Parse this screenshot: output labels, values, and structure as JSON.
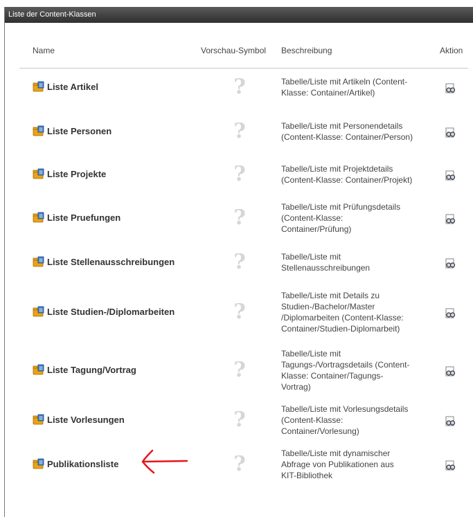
{
  "panel": {
    "title": "Liste der Content-Klassen"
  },
  "columns": {
    "name": "Name",
    "preview": "Vorschau-Symbol",
    "description": "Beschreibung",
    "action": "Aktion"
  },
  "rows": [
    {
      "name": "Liste Artikel",
      "desc": [
        "Tabelle/Liste mit Artikeln (Content-",
        "Klasse: Container/Artikel)"
      ]
    },
    {
      "name": "Liste Personen",
      "desc": [
        "Tabelle/Liste mit Personendetails",
        "(Content-Klasse: Container/Person)"
      ]
    },
    {
      "name": "Liste Projekte",
      "desc": [
        "Tabelle/Liste mit Projektdetails",
        "(Content-Klasse: Container/Projekt)"
      ]
    },
    {
      "name": "Liste Pruefungen",
      "desc": [
        "Tabelle/Liste mit Prüfungsdetails",
        "(Content-Klasse:",
        "Container/Prüfung)"
      ]
    },
    {
      "name": "Liste Stellenausschreibungen",
      "desc": [
        "Tabelle/Liste mit",
        "Stellenausschreibungen"
      ]
    },
    {
      "name": "Liste Studien-/Diplomarbeiten",
      "desc": [
        "Tabelle/Liste mit Details zu",
        "Studien-/Bachelor/Master",
        "/Diplomarbeiten (Content-Klasse:",
        "Container/Studien-Diplomarbeit)"
      ]
    },
    {
      "name": "Liste Tagung/Vortrag",
      "desc": [
        "Tabelle/Liste mit",
        "Tagungs-/Vortragsdetails (Content-",
        "Klasse: Container/Tagungs-",
        "Vortrag)"
      ]
    },
    {
      "name": "Liste Vorlesungen",
      "desc": [
        "Tabelle/Liste mit Vorlesungsdetails",
        "(Content-Klasse:",
        "Container/Vorlesung)"
      ]
    },
    {
      "name": "Publikationsliste",
      "desc": [
        "Tabelle/Liste mit dynamischer",
        "Abfrage von Publikationen aus",
        "KIT-Bibliothek"
      ]
    }
  ],
  "preview_symbol": "?",
  "icons": {
    "row_icon": "folder-list-icon",
    "action_icon": "view-glasses-icon",
    "annotation": "red-arrow-annotation"
  },
  "colors": {
    "titlebar": "#3a3a3a",
    "arrow": "#e8141c",
    "qmark": "#d6d6d6"
  }
}
